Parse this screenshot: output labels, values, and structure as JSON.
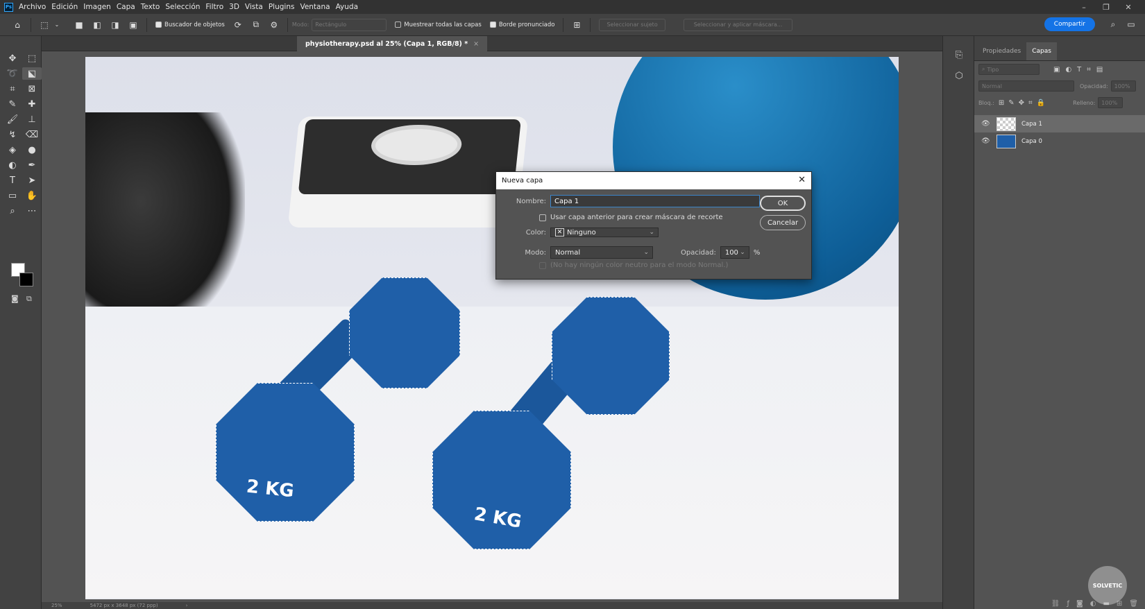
{
  "menu": {
    "logo": "Ps",
    "items": [
      "Archivo",
      "Edición",
      "Imagen",
      "Capa",
      "Texto",
      "Selección",
      "Filtro",
      "3D",
      "Vista",
      "Plugins",
      "Ventana",
      "Ayuda"
    ]
  },
  "options": {
    "object_finder": "Buscador de objetos",
    "mode_label": "Modo:",
    "mode_value": "Rectángulo",
    "sample_all": "Muestrear todas las capas",
    "hard_edge": "Borde pronunciado",
    "select_subject": "Seleccionar sujeto",
    "select_mask": "Seleccionar y aplicar máscara...",
    "share": "Compartir"
  },
  "document": {
    "tab_title": "physiotherapy.psd al 25% (Capa 1, RGB/8) *",
    "close": "×",
    "kg_left": "2 KG",
    "kg_right": "2 KG"
  },
  "status": {
    "zoom": "25%",
    "size": "5472 px x 3648 px (72 ppp)",
    "arrow": "›"
  },
  "panel": {
    "tab_properties": "Propiedades",
    "tab_layers": "Capas",
    "search_placeholder": "Tipo",
    "blend_mode": "Normal",
    "opacity_label": "Opacidad:",
    "opacity_value": "100%",
    "lock_label": "Bloq.:",
    "fill_label": "Relleno:",
    "fill_value": "100%",
    "layers": [
      {
        "name": "Capa 1"
      },
      {
        "name": "Capa 0"
      }
    ]
  },
  "dialog": {
    "title": "Nueva capa",
    "name_label": "Nombre:",
    "name_value": "Capa 1",
    "clip_label": "Usar capa anterior para crear máscara de recorte",
    "color_label": "Color:",
    "color_value": "Ninguno",
    "mode_label": "Modo:",
    "mode_value": "Normal",
    "opacity_label": "Opacidad:",
    "opacity_value": "100",
    "percent": "%",
    "neutral_note": "(No hay ningún color neutro para el modo Normal.)",
    "ok": "OK",
    "cancel": "Cancelar"
  },
  "watermark": "SOLVETIC"
}
